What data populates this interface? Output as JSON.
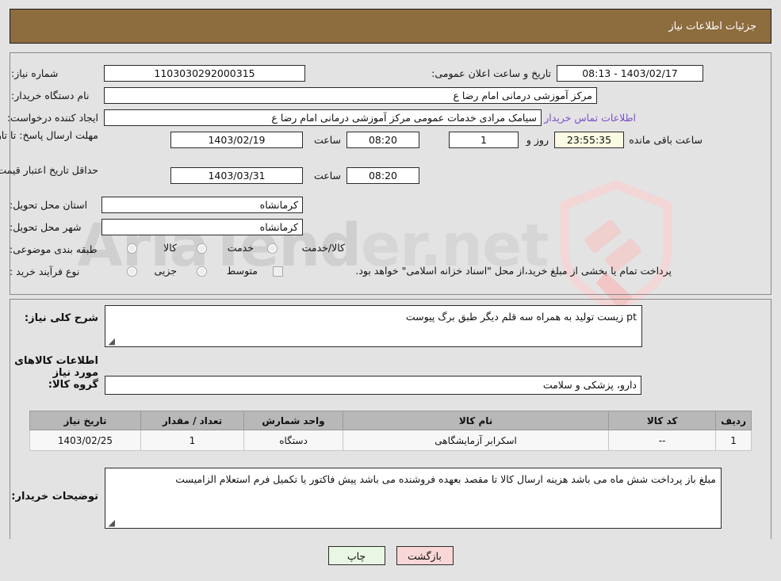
{
  "header": {
    "title": "جزئیات اطلاعات نیاز"
  },
  "form": {
    "need_number_label": "شماره نیاز:",
    "need_number_value": "1103030292000315",
    "announce_datetime_label": "تاریخ و ساعت اعلان عمومی:",
    "announce_datetime_value": "1403/02/17 - 08:13",
    "buyer_org_label": "نام دستگاه خریدار:",
    "buyer_org_value": "مرکز آموزشی  درمانی امام رضا  ع",
    "requester_label": "ایجاد کننده درخواست:",
    "requester_value": "سیامک مرادی خدمات عمومی مرکز آموزشی  درمانی امام رضا  ع",
    "buyer_contact_link": "اطلاعات تماس خریدار",
    "response_deadline_label": "مهلت ارسال پاسخ: تا تاریخ:",
    "response_deadline_date": "1403/02/19",
    "response_deadline_hour_label": "ساعت",
    "response_deadline_hour": "08:20",
    "days_value": "1",
    "days_text": "روز و",
    "countdown_value": "23:55:35",
    "countdown_text": "ساعت باقی مانده",
    "price_validity_label": "حداقل تاریخ اعتبار قیمت: تا تاریخ:",
    "price_validity_date": "1403/03/31",
    "price_validity_hour_label": "ساعت",
    "price_validity_hour": "08:20",
    "province_label": "استان محل تحویل:",
    "province_value": "کرمانشاه",
    "city_label": "شهر محل تحویل:",
    "city_value": "کرمانشاه",
    "classification_label": "طبقه بندی موضوعی:",
    "classification_options": [
      "کالا",
      "خدمت",
      "کالا/خدمت"
    ],
    "process_type_label": "نوع فرآیند خرید :",
    "process_type_options": [
      "جزیی",
      "متوسط"
    ],
    "treasury_note_checkbox_label": "پرداخت تمام یا بخشی از مبلغ خرید،از محل \"اسناد خزانه اسلامی\" خواهد بود."
  },
  "description": {
    "label": "شرح کلی نیاز:",
    "value": "pt  زیست تولید به همراه سه قلم دیگر طبق برگ پیوست"
  },
  "goods_section": {
    "title": "اطلاعات کالاهای مورد نیاز",
    "group_label": "گروه کالا:",
    "group_value": "دارو، پزشکی و سلامت"
  },
  "items_table": {
    "columns": [
      "ردیف",
      "کد کالا",
      "نام کالا",
      "واحد شمارش",
      "تعداد / مقدار",
      "تاریخ نیاز"
    ],
    "rows": [
      {
        "index": "1",
        "code": "--",
        "name": "اسکرابر آزمایشگاهی",
        "unit": "دستگاه",
        "quantity": "1",
        "need_date": "1403/02/25"
      }
    ]
  },
  "buyer_notes": {
    "label": "توضیحات خریدار:",
    "value": "مبلغ باز پرداخت شش ماه می باشد هزینه ارسال کالا تا مقصد بعهده فروشنده می باشد پیش فاکتور یا تکمیل فرم استعلام الزامیست"
  },
  "buttons": {
    "back": "بازگشت",
    "print": "چاپ"
  },
  "watermark": {
    "text_primary": "AriaTend",
    "text_secondary": "er.net"
  },
  "colors": {
    "header_brown": "#8d6c3e",
    "link_purple": "#7b4fc9",
    "countdown_bg": "#fbfbe4",
    "back_button_bg": "#fad7d7",
    "print_button_bg": "#e8f6e3",
    "table_header_bg": "#b8b8b8",
    "page_bg": "#e3e3e3"
  }
}
